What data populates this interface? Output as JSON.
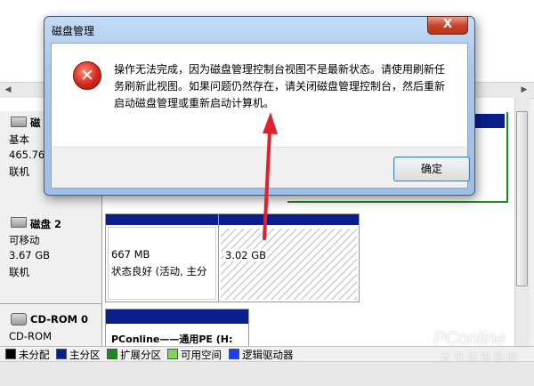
{
  "dialog": {
    "title": "磁盘管理",
    "close_glyph": "X",
    "icon": "error-icon",
    "icon_glyph": "✕",
    "message_lines": [
      "操作无法完成，因为磁盘管理控制台视图不是最新状态。请使用刷新任",
      "务刷新此视图。如果问题仍然存在，请关闭磁盘管理控制台，然后重新",
      "启动磁盘管理或重新启动计算机。"
    ],
    "ok_label": "确定"
  },
  "disks": [
    {
      "title": "磁",
      "lines": [
        "基本",
        "465.76",
        "联机"
      ]
    },
    {
      "title": "磁盘 2",
      "lines": [
        "可移动",
        "3.67 GB",
        "联机"
      ]
    },
    {
      "title": "CD-ROM 0",
      "lines": [
        "CD-ROM"
      ]
    }
  ],
  "partitions": {
    "disk2_p1": {
      "size": "667 MB",
      "status": "状态良好 (活动, 主分"
    },
    "disk2_p2": {
      "size": "3.02 GB"
    },
    "cdrom_p1": {
      "label": "PConline——通用PE (H:"
    }
  },
  "legend": [
    {
      "label": "未分配",
      "color": "#000000"
    },
    {
      "label": "主分区",
      "color": "#0a1e8c"
    },
    {
      "label": "扩展分区",
      "color": "#1e8a1e"
    },
    {
      "label": "可用空间",
      "color": "#7cd957"
    },
    {
      "label": "逻辑驱动器",
      "color": "#1a3cff"
    }
  ],
  "watermark": {
    "brand": "PConline",
    "sub": "太平洋电脑网"
  },
  "colors": {
    "annotation_arrow": "#e0202a",
    "primary_band": "#0a1e8c"
  }
}
